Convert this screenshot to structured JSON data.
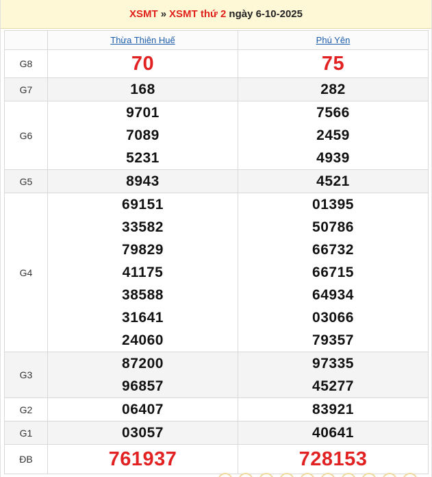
{
  "header": {
    "link1": "XSMT",
    "separator": "»",
    "link2": "XSMT thứ 2",
    "date_text": "ngày 6-10-2025"
  },
  "provinces": [
    "Thừa Thiên Huế",
    "Phú Yên"
  ],
  "prizes": [
    {
      "label": "G8",
      "a": [
        "70"
      ],
      "b": [
        "75"
      ],
      "highlight": true
    },
    {
      "label": "G7",
      "a": [
        "168"
      ],
      "b": [
        "282"
      ]
    },
    {
      "label": "G6",
      "a": [
        "9701",
        "7089",
        "5231"
      ],
      "b": [
        "7566",
        "2459",
        "4939"
      ]
    },
    {
      "label": "G5",
      "a": [
        "8943"
      ],
      "b": [
        "4521"
      ]
    },
    {
      "label": "G4",
      "a": [
        "69151",
        "33582",
        "79829",
        "41175",
        "38588",
        "31641",
        "24060"
      ],
      "b": [
        "01395",
        "50786",
        "66732",
        "66715",
        "64934",
        "03066",
        "79357"
      ]
    },
    {
      "label": "G3",
      "a": [
        "87200",
        "96857"
      ],
      "b": [
        "97335",
        "45277"
      ]
    },
    {
      "label": "G2",
      "a": [
        "06407"
      ],
      "b": [
        "83921"
      ]
    },
    {
      "label": "G1",
      "a": [
        "03057"
      ],
      "b": [
        "40641"
      ]
    },
    {
      "label": "ĐB",
      "a": [
        "761937"
      ],
      "b": [
        "728153"
      ],
      "highlight": true
    }
  ],
  "colors": {
    "accent_red": "#e22222",
    "link_blue": "#1a5aa8",
    "header_bg": "#fff8d7"
  }
}
